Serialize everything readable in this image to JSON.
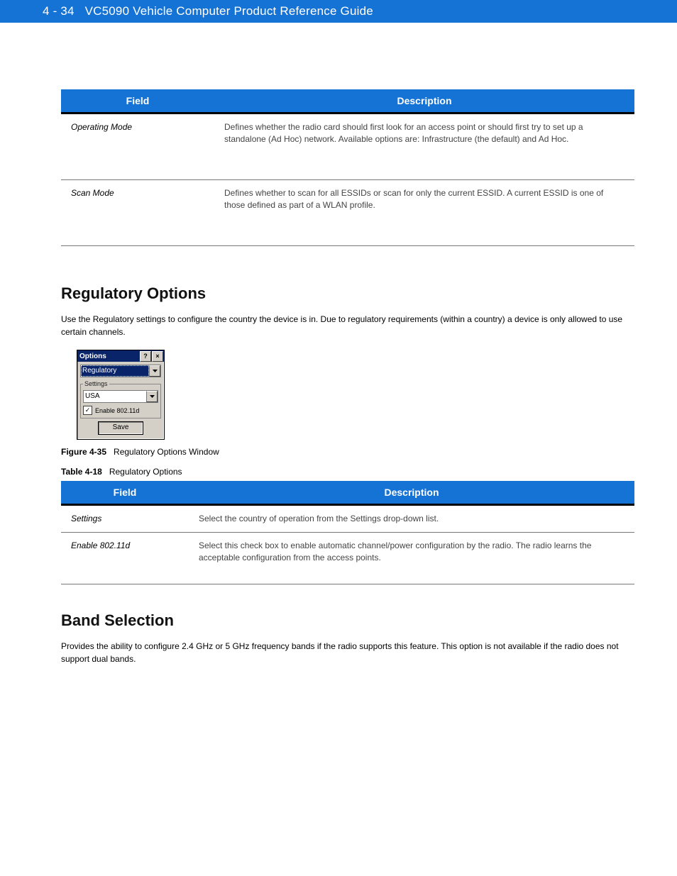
{
  "header": {
    "page_number": "4 - 34",
    "doc_title": "VC5090 Vehicle Computer Product Reference Guide"
  },
  "table1": {
    "field_header": "Field",
    "desc_header": "Description",
    "rows": [
      {
        "field": "Operating Mode",
        "desc": "Defines whether the radio card should first look for an access point or should first try to set up a standalone (Ad Hoc) network. Available options are: Infrastructure (the default) and Ad Hoc."
      },
      {
        "field": "Scan Mode",
        "desc": "Defines whether to scan for all ESSIDs or scan for only the current ESSID. A current ESSID is one of those defined as part of a WLAN profile."
      }
    ]
  },
  "sections": {
    "regulatory": {
      "title": "Regulatory Options",
      "body": "Use the Regulatory settings to configure the country the device is in. Due to regulatory requirements (within a country) a device is only allowed to use certain channels.",
      "figure_label": "Figure 4-35",
      "figure_title": "Regulatory Options Window",
      "table_label": "Table 4-18",
      "table_title": "Regulatory Options"
    },
    "band": {
      "title": "Band Selection",
      "body1": "Provides the ability to configure 2.4 GHz or 5 GHz frequency bands if the radio supports this feature. This option is not available if the radio does not support dual bands.",
      "body2": ""
    }
  },
  "dialog": {
    "title": "Options",
    "field_dropdown": "Regulatory",
    "settings_legend": "Settings",
    "country": "USA",
    "enable_label": "Enable 802.11d",
    "enable_checked": true,
    "save_label": "Save"
  },
  "table2": {
    "field_header": "Field",
    "desc_header": "Description",
    "rows": [
      {
        "field": "Settings",
        "desc": "Select the country of operation from the Settings drop-down list."
      },
      {
        "field": "Enable 802.11d",
        "desc": "Select this check box to enable automatic channel/power configuration by the radio. The radio learns the acceptable configuration from the access points."
      }
    ]
  }
}
